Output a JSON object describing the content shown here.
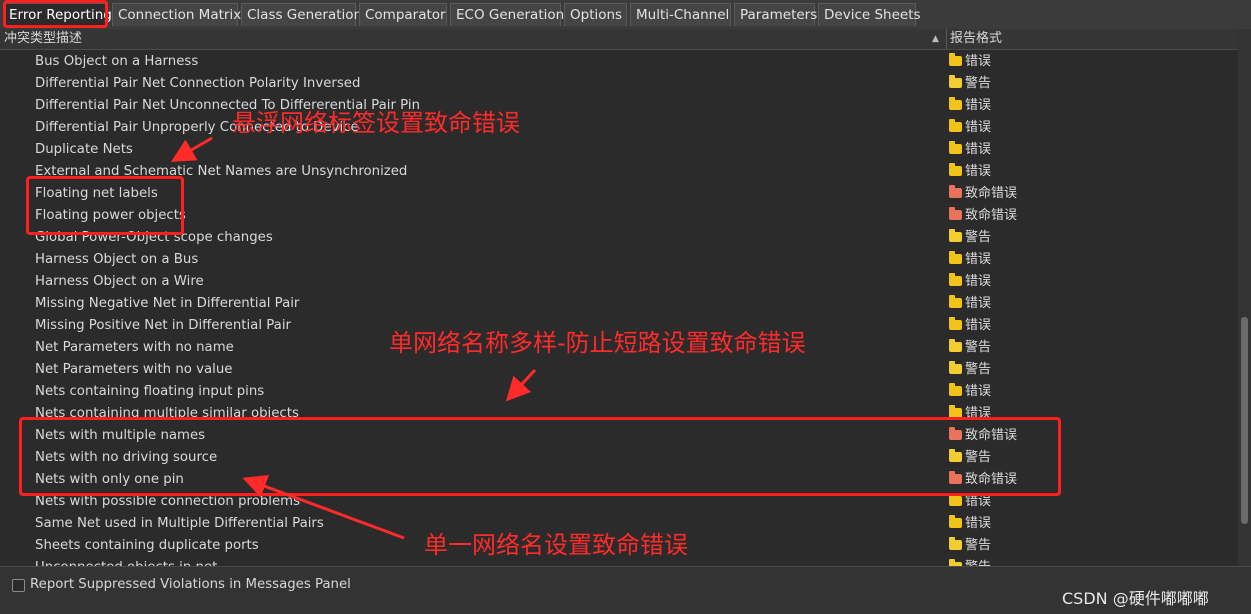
{
  "tabs": [
    {
      "label": "Error Reporting",
      "active": true
    },
    {
      "label": "Connection Matrix"
    },
    {
      "label": "Class Generation"
    },
    {
      "label": "Comparator"
    },
    {
      "label": "ECO Generation"
    },
    {
      "label": "Options"
    },
    {
      "label": "Multi-Channel"
    },
    {
      "label": "Parameters"
    },
    {
      "label": "Device Sheets"
    }
  ],
  "columns": {
    "violation_type": "冲突类型描述",
    "report_mode": "报告格式"
  },
  "rows": [
    {
      "name": "Bus Object on a Harness",
      "level": "错误"
    },
    {
      "name": "Differential Pair Net Connection Polarity Inversed",
      "level": "警告"
    },
    {
      "name": "Differential Pair Net Unconnected To Differerential Pair Pin",
      "level": "错误"
    },
    {
      "name": "Differential Pair Unproperly Connected to Device",
      "level": "错误"
    },
    {
      "name": "Duplicate Nets",
      "level": "错误"
    },
    {
      "name": "External and Schematic Net Names are Unsynchronized",
      "level": "错误"
    },
    {
      "name": "Floating net labels",
      "level": "致命错误"
    },
    {
      "name": "Floating power objects",
      "level": "致命错误"
    },
    {
      "name": "Global Power-Object scope changes",
      "level": "警告"
    },
    {
      "name": "Harness Object on a Bus",
      "level": "错误"
    },
    {
      "name": "Harness Object on a Wire",
      "level": "错误"
    },
    {
      "name": "Missing Negative Net in Differential Pair",
      "level": "错误"
    },
    {
      "name": "Missing Positive Net in Differential Pair",
      "level": "错误"
    },
    {
      "name": "Net Parameters with no name",
      "level": "警告"
    },
    {
      "name": "Net Parameters with no value",
      "level": "警告"
    },
    {
      "name": "Nets containing floating input pins",
      "level": "错误"
    },
    {
      "name": "Nets containing multiple similar objects",
      "level": "错误"
    },
    {
      "name": "Nets with multiple names",
      "level": "致命错误"
    },
    {
      "name": "Nets with no driving source",
      "level": "警告"
    },
    {
      "name": "Nets with only one pin",
      "level": "致命错误"
    },
    {
      "name": "Nets with possible connection problems",
      "level": "错误"
    },
    {
      "name": "Same Net used in Multiple Differential Pairs",
      "level": "错误"
    },
    {
      "name": "Sheets containing duplicate ports",
      "level": "警告"
    },
    {
      "name": "Unconnected objects in net",
      "level": "警告"
    }
  ],
  "level_colors": {
    "错误": "#f2c318",
    "警告": "#f2cd32",
    "致命错误": "#e8735a"
  },
  "footer": {
    "checkbox_label": "Report Suppressed Violations in Messages Panel",
    "watermark": "CSDN @硬件嘟嘟嘟"
  },
  "annotations": {
    "floating_labels": "悬浮网络标签设置致命错误",
    "multiple_names": "单网络名称多样-防止短路设置致命错误",
    "one_pin": "单一网络名设置致命错误"
  }
}
